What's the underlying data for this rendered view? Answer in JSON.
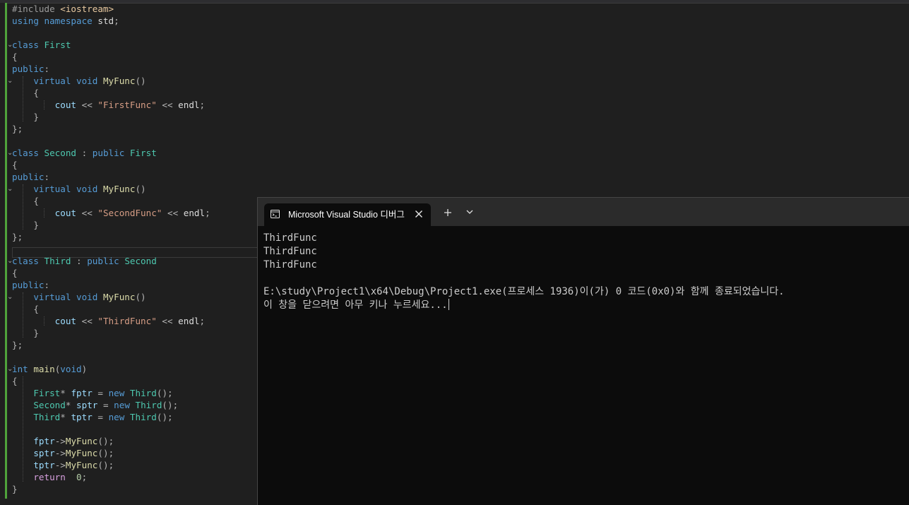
{
  "editor": {
    "lines": [
      "#include <iostream>",
      "using namespace std;",
      "",
      "class First",
      "{",
      "public:",
      "    virtual void MyFunc()",
      "    {",
      "        cout << \"FirstFunc\" << endl;",
      "    }",
      "};",
      "",
      "class Second : public First",
      "{",
      "public:",
      "    virtual void MyFunc()",
      "    {",
      "        cout << \"SecondFunc\" << endl;",
      "    }",
      "};",
      "",
      "class Third : public Second",
      "{",
      "public:",
      "    virtual void MyFunc()",
      "    {",
      "        cout << \"ThirdFunc\" << endl;",
      "    }",
      "};",
      "",
      "int main(void)",
      "{",
      "    First* fptr = new Third();",
      "    Second* sptr = new Third();",
      "    Third* tptr = new Third();",
      "",
      "    fptr->MyFunc();",
      "    sptr->MyFunc();",
      "    tptr->MyFunc();",
      "    return  0;",
      "}"
    ],
    "fold_markers": {
      "3": "⌄",
      "6": "⌄",
      "12": "⌄",
      "15": "⌄",
      "21": "⌄",
      "24": "⌄",
      "30": "⌄"
    }
  },
  "terminal": {
    "tab_title": "Microsoft Visual Studio 디버그",
    "icons": {
      "tab": "console-window-icon",
      "close": "close-icon",
      "new_tab": "plus-icon",
      "menu": "chevron-down-icon"
    },
    "output": [
      "ThirdFunc",
      "ThirdFunc",
      "ThirdFunc",
      "",
      "E:\\study\\Project1\\x64\\Debug\\Project1.exe(프로세스 1936)이(가) 0 코드(0x0)와 함께 종료되었습니다.",
      "이 창을 닫으려면 아무 키나 누르세요..."
    ]
  },
  "colors": {
    "editor_bg": "#1f1f1f",
    "terminal_bg": "#0c0c0c",
    "terminal_titlebar": "#2b2b2b",
    "keyword": "#569cd6",
    "type": "#4ec9b0",
    "function": "#dcdcaa",
    "string": "#d69d85",
    "variable": "#9cdcfe",
    "control": "#d8a0df",
    "change_bar": "#4fa33b"
  }
}
